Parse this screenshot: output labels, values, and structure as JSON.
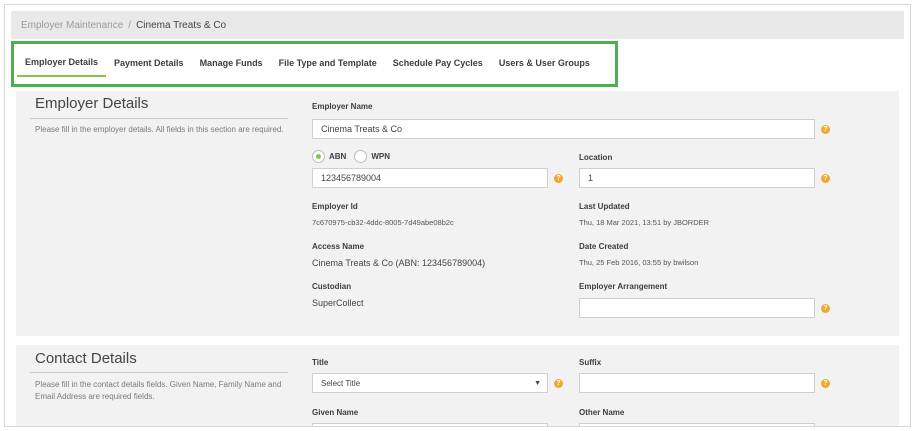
{
  "breadcrumb": {
    "parent": "Employer Maintenance",
    "separator": "/",
    "current": "Cinema Treats & Co"
  },
  "tabs": [
    {
      "label": "Employer Details",
      "active": true
    },
    {
      "label": "Payment Details"
    },
    {
      "label": "Manage Funds"
    },
    {
      "label": "File Type and Template"
    },
    {
      "label": "Schedule Pay Cycles"
    },
    {
      "label": "Users & User Groups"
    }
  ],
  "employer_details": {
    "title": "Employer Details",
    "description": "Please fill in the employer details. All fields in this section are required.",
    "employer_name_label": "Employer Name",
    "employer_name_value": "Cinema Treats & Co",
    "abn_label": "ABN",
    "wpn_label": "WPN",
    "abn_value": "123456789004",
    "location_label": "Location",
    "location_value": "1",
    "employer_id_label": "Employer Id",
    "employer_id_value": "7c670975-cb32-4ddc-8005-7d49abe08b2c",
    "last_updated_label": "Last Updated",
    "last_updated_value": "Thu, 18 Mar 2021, 13:51 by JBORDER",
    "access_name_label": "Access Name",
    "access_name_value": "Cinema Treats & Co (ABN: 123456789004)",
    "date_created_label": "Date Created",
    "date_created_value": "Thu, 25 Feb 2016, 03:55 by bwilson",
    "custodian_label": "Custodian",
    "custodian_value": "SuperCollect",
    "employer_arrangement_label": "Employer Arrangement",
    "employer_arrangement_value": ""
  },
  "contact_details": {
    "title": "Contact Details",
    "description": "Please fill in the contact details fields. Given Name, Family Name and Email Address are required fields.",
    "title_label": "Title",
    "title_select": "Select Title",
    "suffix_label": "Suffix",
    "suffix_value": "",
    "given_name_label": "Given Name",
    "other_name_label": "Other Name"
  },
  "help_icon_glyph": "?",
  "colors": {
    "highlight": "#4caf50",
    "active_tab": "#8bc34a",
    "help": "#f0a830",
    "radio_on": "#8bc34a"
  }
}
